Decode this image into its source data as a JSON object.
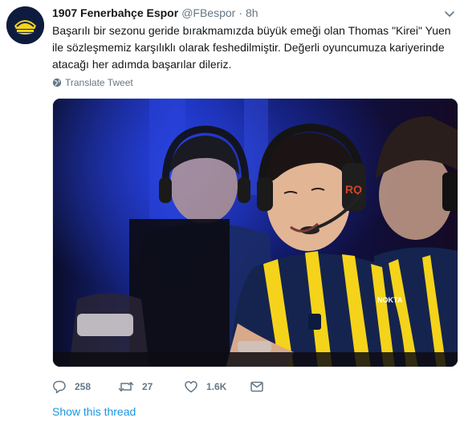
{
  "account": {
    "display_name": "1907 Fenerbahçe Espor",
    "handle": "@FBespor",
    "separator": "·",
    "time": "8h"
  },
  "tweet": {
    "lines": [
      "Başarılı bir sezonu geride bırakmamızda büyük emeği olan Thomas \"Kirei\" Yuen",
      "ile sözleşmemiz karşılıklı olarak feshedilmiştir. Değerli oyuncumuza kariyerinde",
      "atacağı her adımda başarılar dileriz."
    ]
  },
  "translate_label": "Translate Tweet",
  "actions": {
    "replies": "258",
    "retweets": "27",
    "likes": "1.6K"
  },
  "show_thread_label": "Show this thread",
  "colors": {
    "text": "#14171a",
    "secondary": "#657786",
    "link": "#1b95e0",
    "avatar_bg": "#0d1b3e",
    "jersey_yellow": "#f5d31a",
    "jersey_navy": "#14244f"
  },
  "icons": {
    "caret": "chevron-down-icon",
    "translate": "globe-icon",
    "reply": "reply-icon",
    "retweet": "retweet-icon",
    "like": "heart-icon",
    "message": "envelope-icon"
  }
}
